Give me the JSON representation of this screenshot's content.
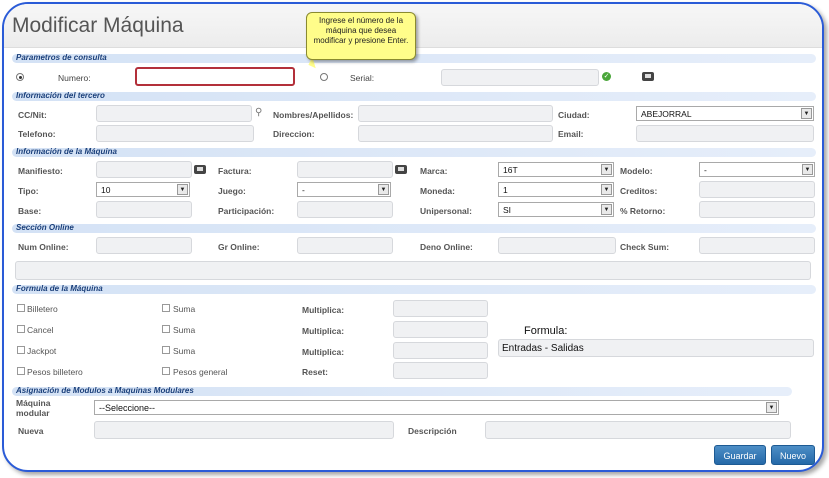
{
  "page": {
    "title": "Modificar Máquina"
  },
  "tooltip": {
    "text": "Ingrese el número de la máquina que desea modificar y presione Enter."
  },
  "sections": {
    "consulta": "Parametros de consulta",
    "tercero": "Información del tercero",
    "maquina": "Información de la Máquina",
    "online": "Sección Online",
    "formula": "Formula de la Máquina",
    "modulos": "Asignación de Modulos a Maquinas Modulares"
  },
  "consulta": {
    "numero_label": "Numero:",
    "numero_value": "",
    "serial_label": "Serial:",
    "serial_value": ""
  },
  "tercero": {
    "ccnit_label": "CC/Nit:",
    "nombres_label": "Nombres/Apellidos:",
    "ciudad_label": "Ciudad:",
    "ciudad_value": "ABEJORRAL",
    "telefono_label": "Telefono:",
    "direccion_label": "Direccion:",
    "email_label": "Email:"
  },
  "maquina": {
    "manifiesto_label": "Manifiesto:",
    "factura_label": "Factura:",
    "marca_label": "Marca:",
    "marca_value": "16T",
    "modelo_label": "Modelo:",
    "modelo_value": "-",
    "tipo_label": "Tipo:",
    "tipo_value": "10",
    "juego_label": "Juego:",
    "juego_value": "-",
    "moneda_label": "Moneda:",
    "moneda_value": "1",
    "creditos_label": "Creditos:",
    "base_label": "Base:",
    "participacion_label": "Participación:",
    "unipersonal_label": "Unipersonal:",
    "unipersonal_value": "SI",
    "retorno_label": "% Retorno:"
  },
  "online": {
    "num_label": "Num Online:",
    "gr_label": "Gr Online:",
    "deno_label": "Deno Online:",
    "check_label": "Check Sum:"
  },
  "formula": {
    "billetero": "Billetero",
    "cancel": "Cancel",
    "jackpot": "Jackpot",
    "pesos_billetero": "Pesos billetero",
    "suma": "Suma",
    "pesos_general": "Pesos general",
    "multiplica": "Multiplica:",
    "reset": "Reset:",
    "formula_title": "Formula:",
    "formula_value": "Entradas - Salidas"
  },
  "modulos": {
    "maquina_label": "Máquina modular",
    "maquina_value": "--Seleccione--",
    "nueva_label": "Nueva",
    "descripcion_label": "Descripción"
  },
  "buttons": {
    "guardar": "Guardar",
    "nuevo": "Nuevo"
  },
  "colors": {
    "accent": "#2569a8",
    "frame": "#2a5bd7",
    "section_text": "#1a3f7a",
    "tooltip_bg": "#fffd8a"
  }
}
